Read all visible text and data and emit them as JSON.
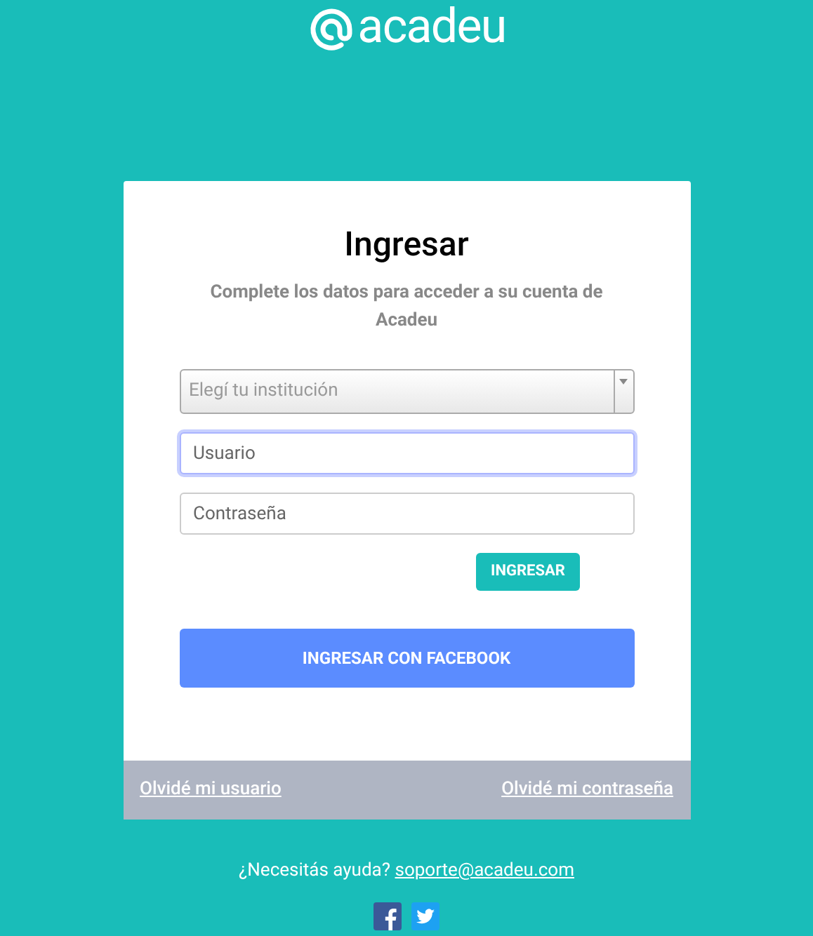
{
  "logo": {
    "text": "acadeu"
  },
  "card": {
    "title": "Ingresar",
    "subtitle": "Complete los datos para acceder a su cuenta de Acadeu",
    "institution_select": {
      "placeholder": "Elegí tu institución"
    },
    "fields": [
      {
        "placeholder": "Usuario",
        "focused": true
      },
      {
        "placeholder": "Contraseña",
        "focused": false
      }
    ],
    "submit_button": "INGRESAR",
    "facebook_button": "INGRESAR CON FACEBOOK"
  },
  "card_footer": {
    "links": [
      "Olvidé mi usuario",
      "Olvidé mi contraseña"
    ]
  },
  "help": {
    "text": "¿Necesitás ayuda?",
    "email": "soporte@acadeu.com"
  },
  "social": [
    {
      "kind": "facebook"
    },
    {
      "kind": "twitter"
    }
  ]
}
